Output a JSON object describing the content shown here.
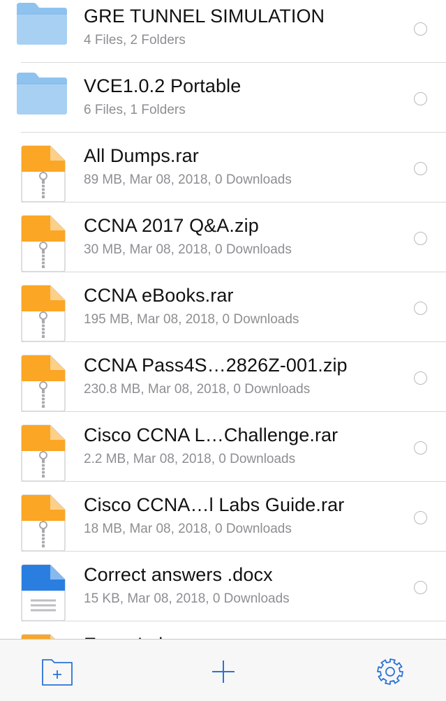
{
  "colors": {
    "folder": "#8fc3ef",
    "archive": "#fba624",
    "document": "#2a7ee0",
    "accent": "#2a73d6"
  },
  "items": [
    {
      "type": "folder",
      "icon": "folder-icon",
      "title": "GRE TUNNEL SIMULATION",
      "subtitle": "4 Files, 2 Folders"
    },
    {
      "type": "folder",
      "icon": "folder-icon",
      "title": "VCE1.0.2 Portable",
      "subtitle": "6 Files, 1 Folders"
    },
    {
      "type": "archive",
      "icon": "zip-file-icon",
      "title": "All Dumps.rar",
      "subtitle": "89 MB, Mar 08, 2018, 0 Downloads"
    },
    {
      "type": "archive",
      "icon": "zip-file-icon",
      "title": "CCNA 2017 Q&A.zip",
      "subtitle": "30 MB, Mar 08, 2018, 0 Downloads"
    },
    {
      "type": "archive",
      "icon": "zip-file-icon",
      "title": "CCNA eBooks.rar",
      "subtitle": "195 MB, Mar 08, 2018, 0 Downloads"
    },
    {
      "type": "archive",
      "icon": "zip-file-icon",
      "title": "CCNA Pass4S…2826Z-001.zip",
      "subtitle": "230.8 MB, Mar 08, 2018, 0 Downloads"
    },
    {
      "type": "archive",
      "icon": "zip-file-icon",
      "title": "Cisco CCNA L…Challenge.rar",
      "subtitle": "2.2 MB, Mar 08, 2018, 0 Downloads"
    },
    {
      "type": "archive",
      "icon": "zip-file-icon",
      "title": "Cisco CCNA…l Labs Guide.rar",
      "subtitle": "18 MB, Mar 08, 2018, 0 Downloads"
    },
    {
      "type": "document",
      "icon": "document-icon",
      "title": "Correct answers .docx",
      "subtitle": "15 KB, Mar 08, 2018, 0 Downloads"
    },
    {
      "type": "archive",
      "icon": "zip-file-icon",
      "title": "Exam Labs",
      "subtitle": ""
    }
  ],
  "toolbar": {
    "new_folder_icon": "new-folder-icon",
    "add_icon": "plus-icon",
    "settings_icon": "gear-icon"
  }
}
